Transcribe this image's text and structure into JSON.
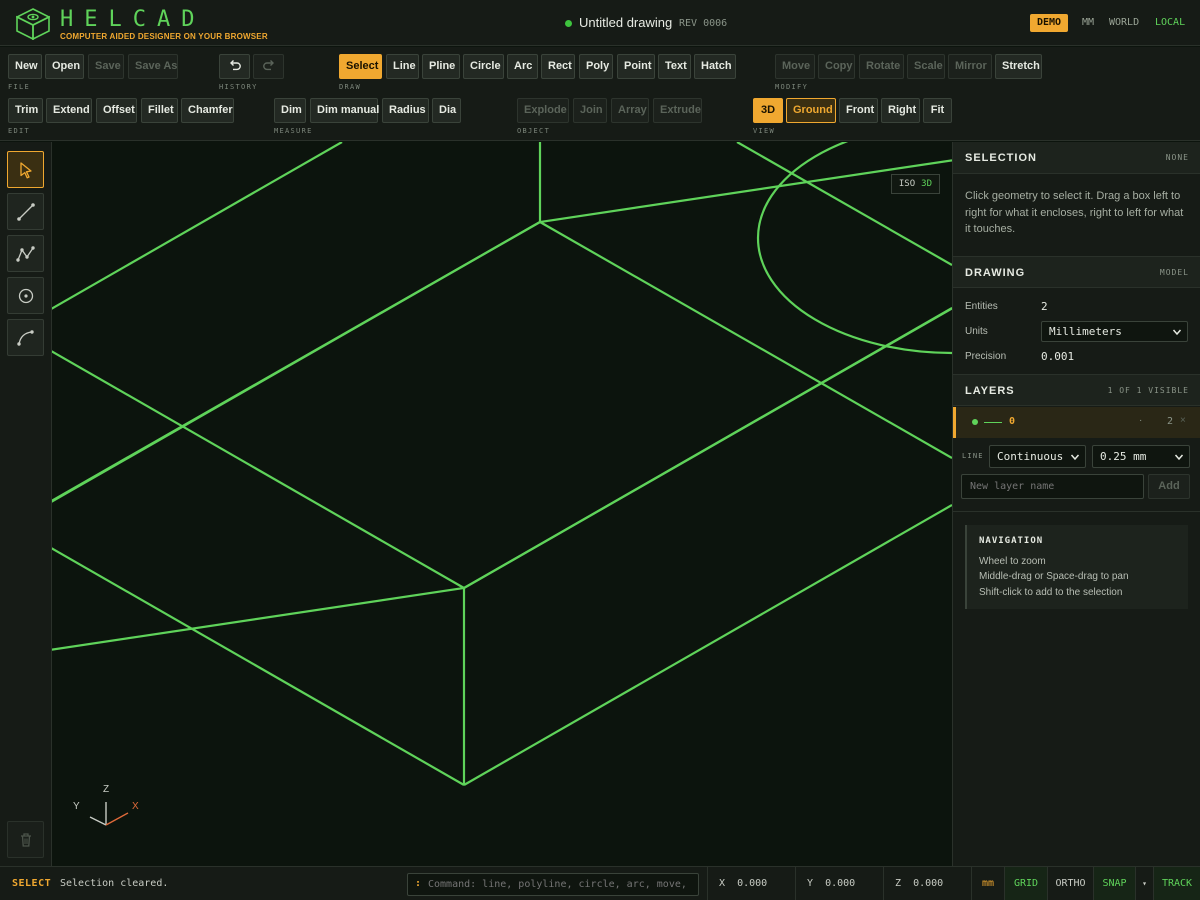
{
  "app": {
    "logo_text": "HELCAD",
    "logo_sub": "COMPUTER AIDED DESIGNER ON YOUR BROWSER",
    "doc_title": "Untitled drawing",
    "rev": "REV 0006",
    "badge": "DEMO",
    "units_toggle": "MM",
    "frame_world": "WORLD",
    "frame_local": "LOCAL"
  },
  "toolbar": {
    "file": {
      "label": "FILE",
      "buttons": [
        "New",
        "Open",
        "Save",
        "Save As"
      ]
    },
    "history": {
      "label": "HISTORY"
    },
    "draw": {
      "label": "DRAW",
      "buttons": [
        "Select",
        "Line",
        "Pline",
        "Circle",
        "Arc",
        "Rect",
        "Poly",
        "Point",
        "Text",
        "Hatch"
      ]
    },
    "modify": {
      "label": "MODIFY",
      "buttons": [
        "Move",
        "Copy",
        "Rotate",
        "Scale",
        "Mirror",
        "Stretch"
      ]
    },
    "edit": {
      "label": "EDIT",
      "buttons": [
        "Trim",
        "Extend",
        "Offset",
        "Fillet",
        "Chamfer"
      ]
    },
    "measure": {
      "label": "MEASURE",
      "buttons": [
        "Dim",
        "Dim manual",
        "Radius",
        "Dia"
      ]
    },
    "object": {
      "label": "OBJECT",
      "buttons": [
        "Explode",
        "Join",
        "Array",
        "Extrude"
      ]
    },
    "view": {
      "label": "VIEW",
      "buttons": [
        "3D",
        "Ground",
        "Front",
        "Right",
        "Fit"
      ]
    }
  },
  "rail": {
    "tools": [
      "select-tool",
      "line-tool",
      "polyline-tool",
      "circle-tool",
      "arc-tool"
    ]
  },
  "viewport": {
    "badge_mode": "ISO",
    "badge_dim": "3D",
    "axes": {
      "x": "X",
      "y": "Y",
      "z": "Z"
    },
    "line_color": "#5fd35a"
  },
  "panel": {
    "selection": {
      "title": "SELECTION",
      "meta": "NONE",
      "help": "Click geometry to select it. Drag a box left to right for what it encloses, right to left for what it touches."
    },
    "drawing": {
      "title": "DRAWING",
      "meta": "MODEL",
      "entities_label": "Entities",
      "entities_value": "2",
      "units_label": "Units",
      "units_value": "Millimeters",
      "precision_label": "Precision",
      "precision_value": "0.001"
    },
    "layers": {
      "title": "LAYERS",
      "meta": "1 OF 1 VISIBLE",
      "items": [
        {
          "name": "0",
          "count": "2",
          "dot": "·",
          "close": "×"
        }
      ],
      "line_label": "LINE",
      "linetype": "Continuous",
      "lineweight": "0.25 mm",
      "new_placeholder": "New layer name",
      "add_label": "Add"
    },
    "navigation": {
      "title": "NAVIGATION",
      "tips": [
        "Wheel to zoom",
        "Middle-drag or Space-drag to pan",
        "Shift-click to add to the selection"
      ]
    }
  },
  "status": {
    "mode": "SELECT",
    "message": "Selection cleared.",
    "prompt": ":",
    "command_placeholder": "Command: line, polyline, circle, arc, move,",
    "x_label": "X",
    "x_value": "0.000",
    "y_label": "Y",
    "y_value": "0.000",
    "z_label": "Z",
    "z_value": "0.000",
    "units": "mm",
    "grid": "GRID",
    "ortho": "ORTHO",
    "snap": "SNAP",
    "snap_menu": "▾",
    "track": "TRACK"
  }
}
